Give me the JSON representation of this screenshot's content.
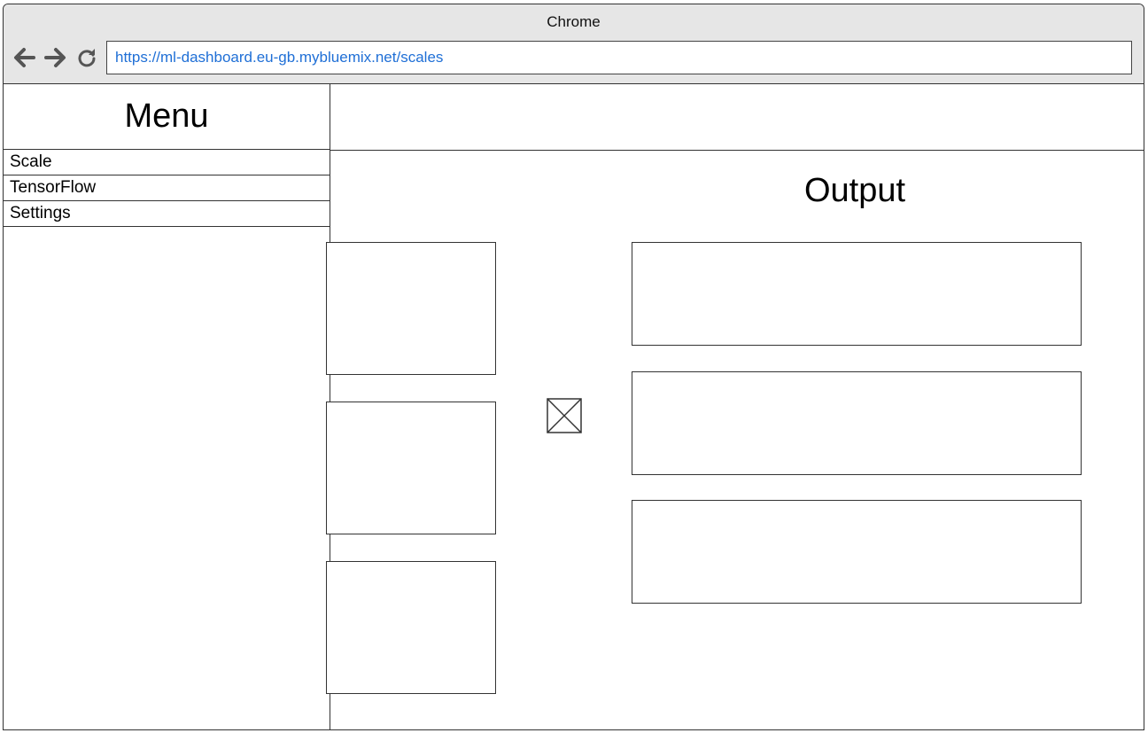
{
  "window": {
    "title": "Chrome"
  },
  "toolbar": {
    "back_icon": "arrow-left-icon",
    "forward_icon": "arrow-right-icon",
    "reload_icon": "reload-icon",
    "url": "https://ml-dashboard.eu-gb.mybluemix.net/scales"
  },
  "sidebar": {
    "title": "Menu",
    "items": [
      {
        "label": "Scale"
      },
      {
        "label": "TensorFlow"
      },
      {
        "label": "Settings"
      }
    ]
  },
  "main": {
    "output_title": "Output",
    "placeholder_icon": "image-placeholder-icon"
  }
}
